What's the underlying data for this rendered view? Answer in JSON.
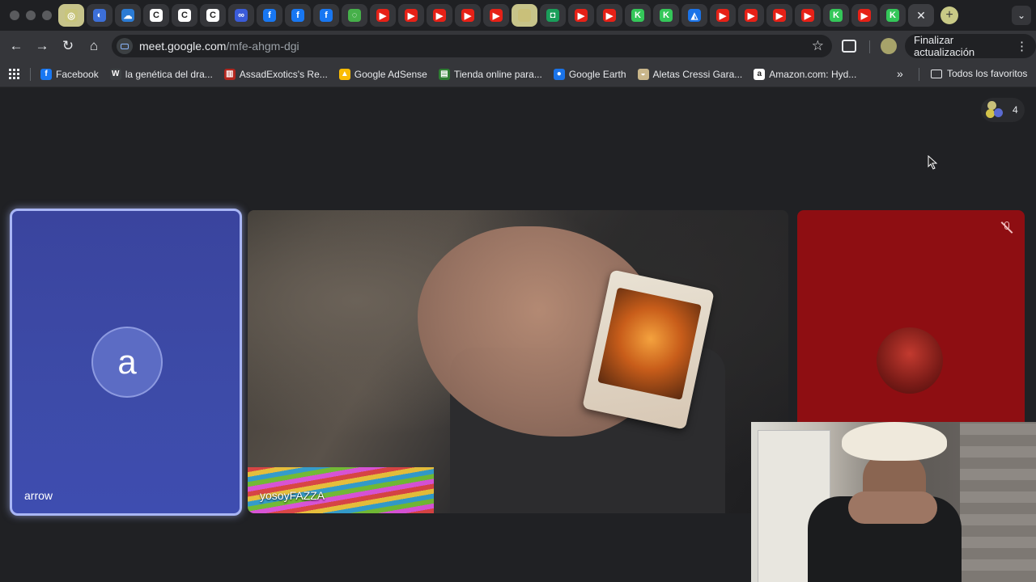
{
  "browser": {
    "tab_count": 30,
    "active_tab_close": "✕",
    "new_tab": "+",
    "url_host": "meet.google.com",
    "url_path": "/mfe-ahgm-dgi",
    "update_button": "Finalizar actualización"
  },
  "bookmarks": [
    {
      "label": "Facebook",
      "icon_color": "#1877f2",
      "icon": "f"
    },
    {
      "label": "la genética del dra...",
      "icon_color": "#3c4043",
      "icon": "W"
    },
    {
      "label": "AssadExotics's Re...",
      "icon_color": "#b3261e",
      "icon": "▥"
    },
    {
      "label": "Google AdSense",
      "icon_color": "#fbbc04",
      "icon": "▲"
    },
    {
      "label": "Tienda online para...",
      "icon_color": "#2e7d32",
      "icon": "▤"
    },
    {
      "label": "Google Earth",
      "icon_color": "#1a73e8",
      "icon": "●"
    },
    {
      "label": "Aletas Cressi Gara...",
      "icon_color": "#c9b68a",
      "icon": "◒"
    },
    {
      "label": "Amazon.com: Hyd...",
      "icon_color": "#ffffff",
      "icon": "a"
    }
  ],
  "bookmarks_more": "»",
  "all_favorites": "Todos los favoritos",
  "meet": {
    "participants_count": "4",
    "tiles": [
      {
        "name": "arrow",
        "initial": "a"
      },
      {
        "name": "yosoyFAZZA"
      }
    ]
  },
  "colors": {
    "arrow_tile": "#3d4ba8",
    "red_tile": "#8e0e12",
    "background": "#202124"
  }
}
